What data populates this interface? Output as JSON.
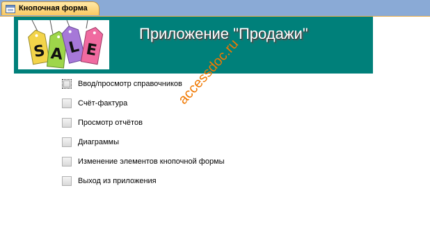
{
  "tab": {
    "title": "Кнопочная форма",
    "icon": "form-icon"
  },
  "header": {
    "title": "Приложение \"Продажи\"",
    "logo_text": "SALE",
    "background": "#00807a"
  },
  "menu": {
    "items": [
      {
        "label": "Ввод/просмотр справочников"
      },
      {
        "label": "Счёт-фактура"
      },
      {
        "label": "Просмотр отчётов"
      },
      {
        "label": "Диаграммы"
      },
      {
        "label": "Изменение элементов кнопочной формы"
      },
      {
        "label": "Выход из приложения"
      }
    ]
  },
  "watermark": "accessdoc.ru",
  "colors": {
    "accent": "#00807a",
    "tab": "#f9c862",
    "watermark": "#f07800"
  }
}
